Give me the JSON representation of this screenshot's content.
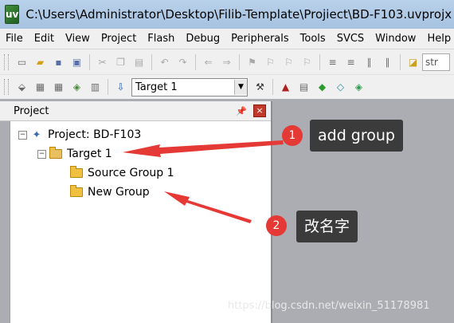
{
  "window": {
    "title": "C:\\Users\\Administrator\\Desktop\\Filib-Template\\Projiect\\BD-F103.uvprojx -",
    "app_icon": "uv"
  },
  "menu": [
    "File",
    "Edit",
    "View",
    "Project",
    "Flash",
    "Debug",
    "Peripherals",
    "Tools",
    "SVCS",
    "Window",
    "Help"
  ],
  "toolbar": {
    "target_select": "Target 1",
    "search_text": "str"
  },
  "panel": {
    "title": "Project",
    "pin_icon": "pin-icon",
    "close_icon": "close-icon"
  },
  "tree": {
    "project": "Project: BD-F103",
    "target": "Target 1",
    "groups": [
      "Source Group 1",
      "New Group"
    ],
    "expand_minus": "−"
  },
  "annotations": {
    "badge1": "1",
    "callout1": "add group",
    "badge2": "2",
    "callout2": "改名字",
    "arrow_color": "#e53935"
  },
  "watermark": "https://blog.csdn.net/weixin_51178981"
}
